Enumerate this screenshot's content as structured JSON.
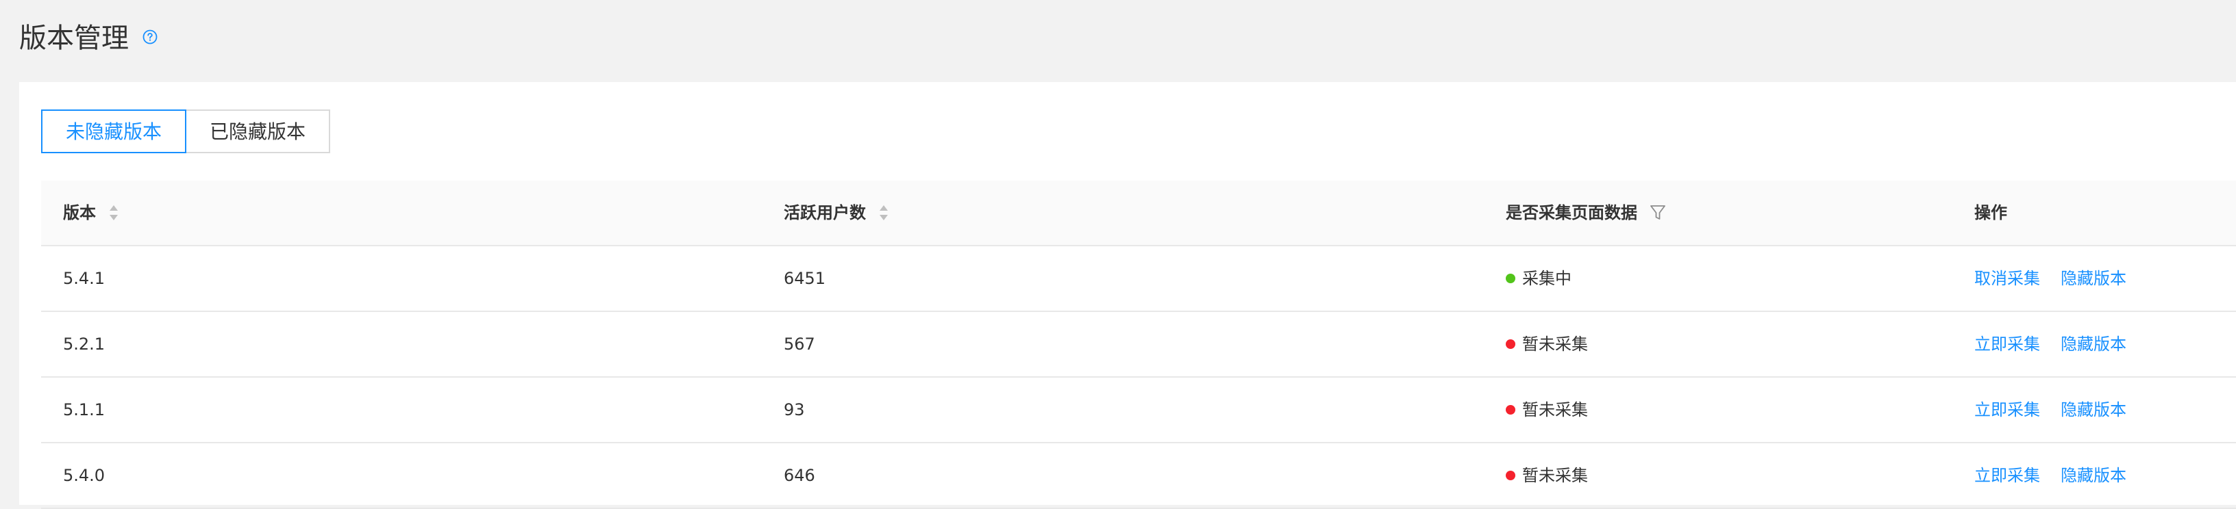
{
  "page": {
    "title": "版本管理",
    "help_icon": "question-circle-icon"
  },
  "tabs": [
    {
      "label": "未隐藏版本",
      "active": true
    },
    {
      "label": "已隐藏版本",
      "active": false
    }
  ],
  "colors": {
    "accent": "#1890ff",
    "status_active": "#52c41a",
    "status_inactive": "#f5222d",
    "header_bg": "#fafafa",
    "border": "#e8e8e8"
  },
  "table": {
    "columns": [
      {
        "label": "版本",
        "icon": "sort-icon"
      },
      {
        "label": "活跃用户数",
        "icon": "sort-icon"
      },
      {
        "label": "是否采集页面数据",
        "icon": "filter-icon"
      },
      {
        "label": "操作"
      }
    ],
    "rows": [
      {
        "version": "5.4.1",
        "users": "6451",
        "status": "采集中",
        "status_color": "#52c41a",
        "actions": [
          "取消采集",
          "隐藏版本"
        ]
      },
      {
        "version": "5.2.1",
        "users": "567",
        "status": "暂未采集",
        "status_color": "#f5222d",
        "actions": [
          "立即采集",
          "隐藏版本"
        ]
      },
      {
        "version": "5.1.1",
        "users": "93",
        "status": "暂未采集",
        "status_color": "#f5222d",
        "actions": [
          "立即采集",
          "隐藏版本"
        ]
      },
      {
        "version": "5.4.0",
        "users": "646",
        "status": "暂未采集",
        "status_color": "#f5222d",
        "actions": [
          "立即采集",
          "隐藏版本"
        ]
      }
    ]
  }
}
